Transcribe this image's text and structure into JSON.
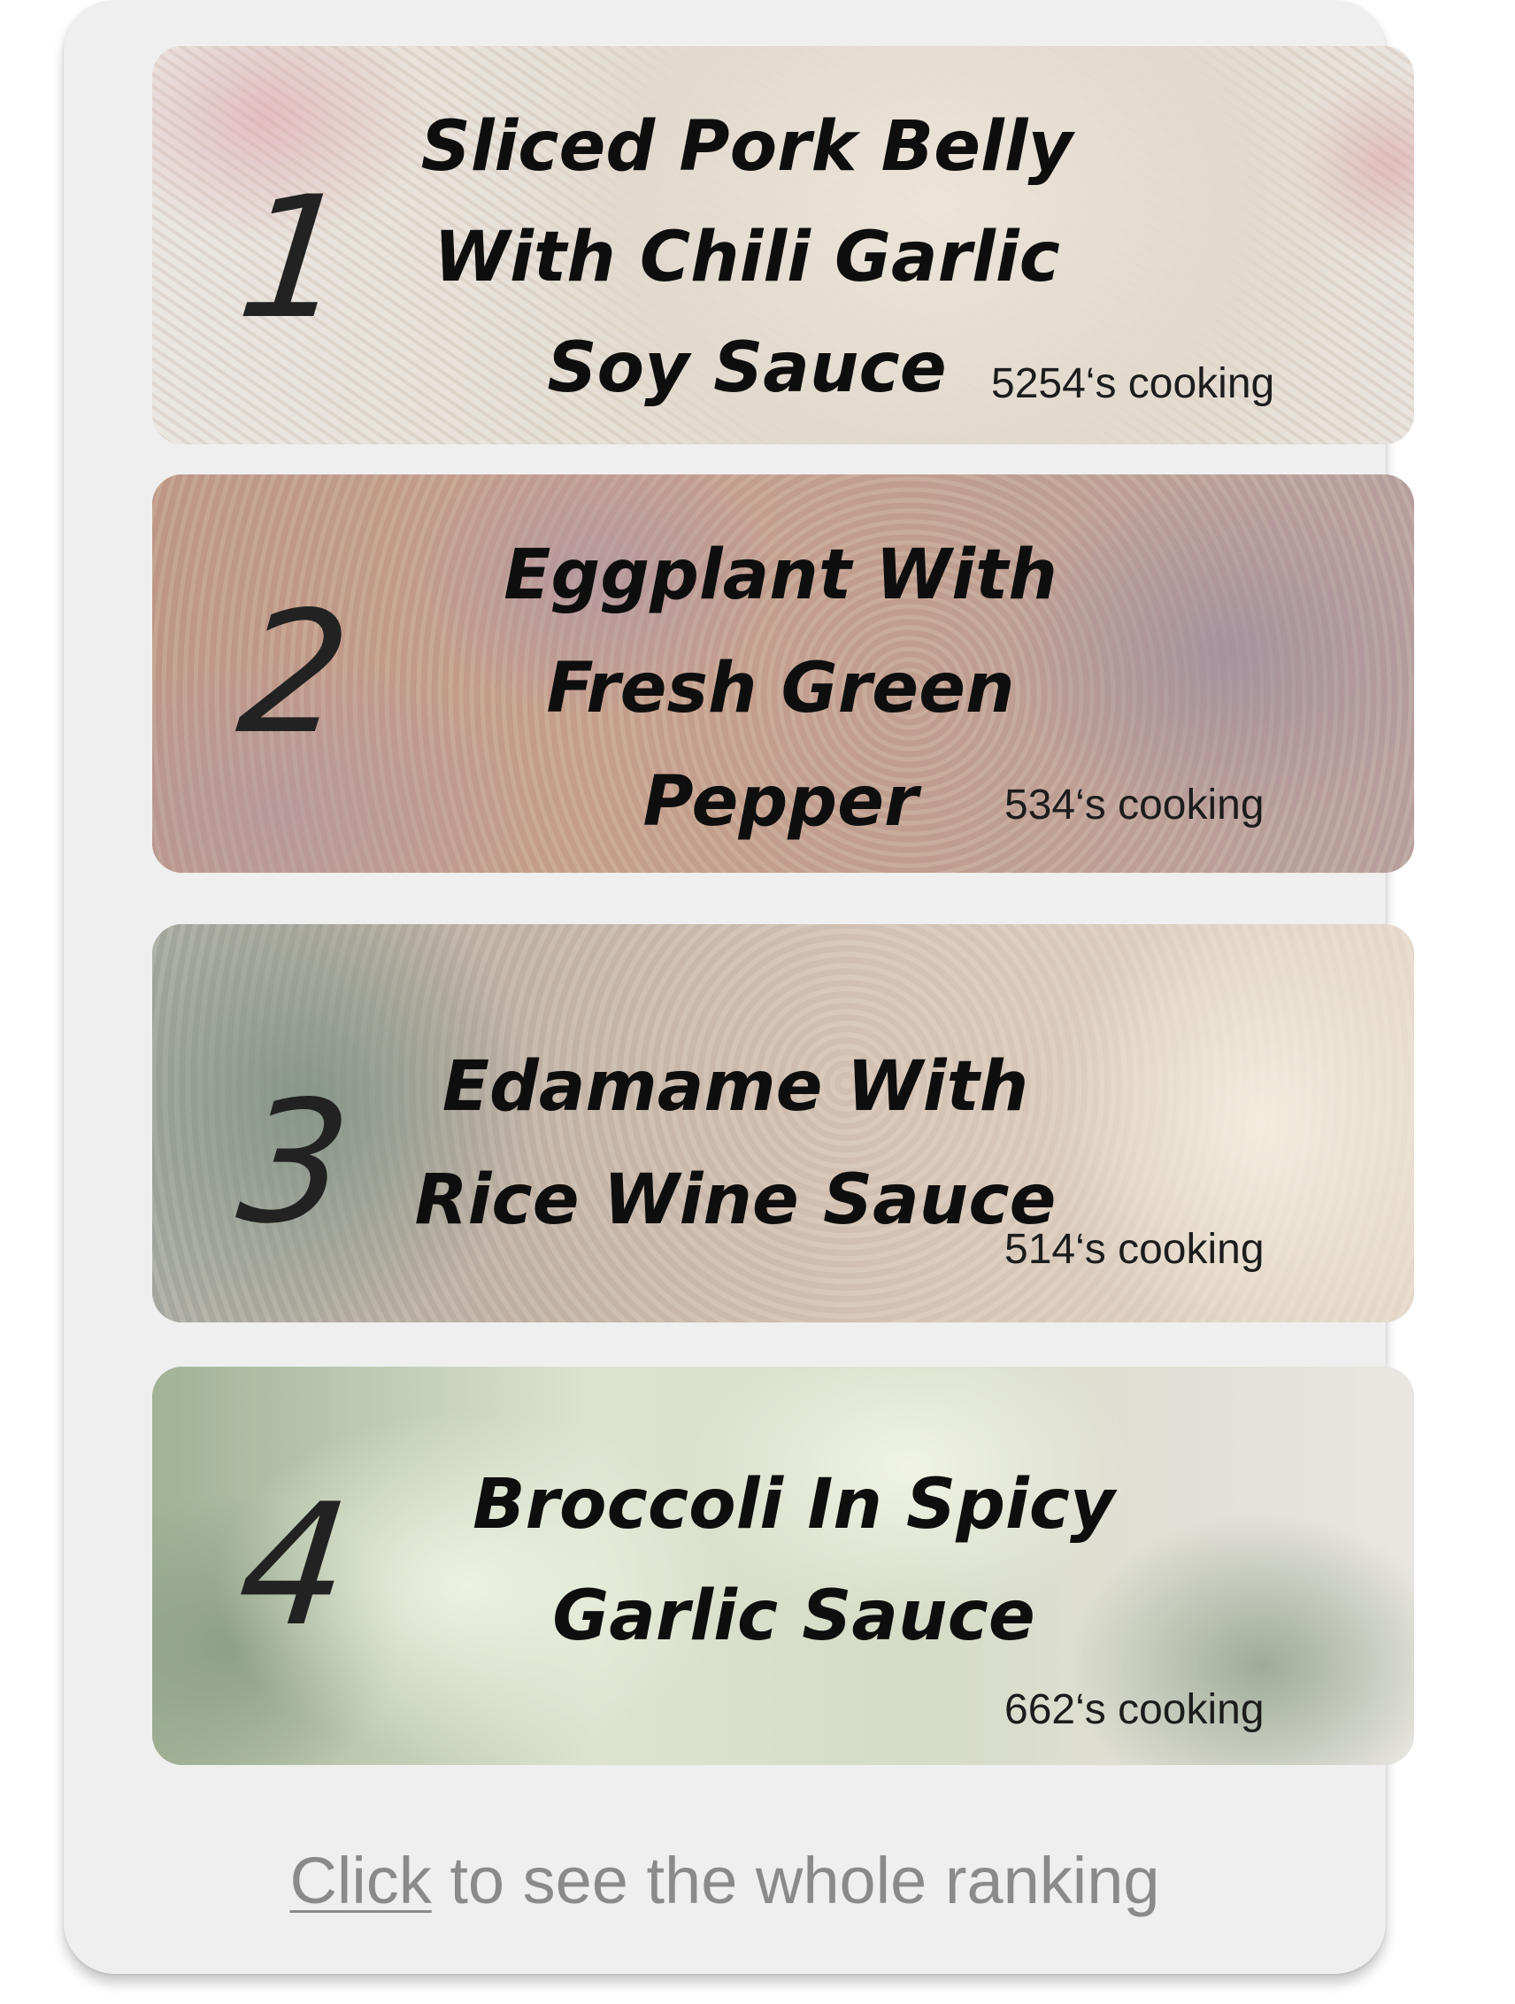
{
  "ranking": [
    {
      "rank": "1",
      "title_lines": [
        "Sliced Pork Belly",
        "With Chili Garlic",
        "Soy Sauce"
      ],
      "cooking": "5254‘s cooking"
    },
    {
      "rank": "2",
      "title_lines": [
        "Eggplant With",
        "Fresh Green",
        "Pepper"
      ],
      "cooking": "534‘s cooking"
    },
    {
      "rank": "3",
      "title_lines": [
        "Edamame With",
        "Rice Wine Sauce"
      ],
      "cooking": "514‘s cooking"
    },
    {
      "rank": "4",
      "title_lines": [
        "Broccoli In Spicy",
        "Garlic Sauce"
      ],
      "cooking": "662‘s cooking"
    }
  ],
  "footer": {
    "link_text": "Click",
    "rest_text": " to see the whole ranking"
  }
}
